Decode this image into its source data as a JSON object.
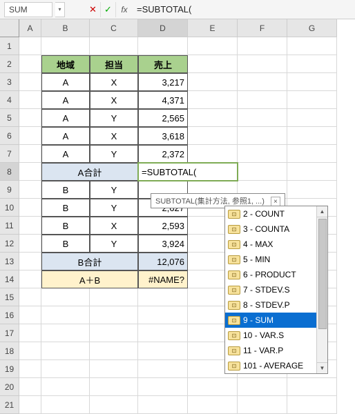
{
  "formula_bar": {
    "name_box": "SUM",
    "cancel": "✕",
    "ok": "✓",
    "fx": "fx",
    "formula": "=SUBTOTAL("
  },
  "columns": [
    "A",
    "B",
    "C",
    "D",
    "E",
    "F",
    "G"
  ],
  "rows": [
    "1",
    "2",
    "3",
    "4",
    "5",
    "6",
    "7",
    "8",
    "9",
    "10",
    "11",
    "12",
    "13",
    "14",
    "15",
    "16",
    "17",
    "18",
    "19",
    "20",
    "21"
  ],
  "headers": {
    "region": "地域",
    "rep": "担当",
    "sales": "売上"
  },
  "data": {
    "rows": [
      {
        "region": "A",
        "rep": "X",
        "sales": "3,217"
      },
      {
        "region": "A",
        "rep": "X",
        "sales": "4,371"
      },
      {
        "region": "A",
        "rep": "Y",
        "sales": "2,565"
      },
      {
        "region": "A",
        "rep": "X",
        "sales": "3,618"
      },
      {
        "region": "A",
        "rep": "Y",
        "sales": "2,372"
      }
    ],
    "subtotal_a_label": "A合計",
    "subtotal_a_edit": "=SUBTOTAL(",
    "rowsB": [
      {
        "region": "B",
        "rep": "Y",
        "sales": ""
      },
      {
        "region": "B",
        "rep": "Y",
        "sales": "2,627"
      },
      {
        "region": "B",
        "rep": "X",
        "sales": "2,593"
      },
      {
        "region": "B",
        "rep": "Y",
        "sales": "3,924"
      }
    ],
    "subtotal_b_label": "B合計",
    "subtotal_b_value": "12,076",
    "total_label": "A＋B",
    "total_value": "#NAME?"
  },
  "tooltip": {
    "text": "SUBTOTAL(集計方法, 参照1, ...)",
    "close": "×"
  },
  "dropdown": {
    "items": [
      {
        "label": "2 - COUNT",
        "selected": false
      },
      {
        "label": "3 - COUNTA",
        "selected": false
      },
      {
        "label": "4 - MAX",
        "selected": false
      },
      {
        "label": "5 - MIN",
        "selected": false
      },
      {
        "label": "6 - PRODUCT",
        "selected": false
      },
      {
        "label": "7 - STDEV.S",
        "selected": false
      },
      {
        "label": "8 - STDEV.P",
        "selected": false
      },
      {
        "label": "9 - SUM",
        "selected": true
      },
      {
        "label": "10 - VAR.S",
        "selected": false
      },
      {
        "label": "11 - VAR.P",
        "selected": false
      },
      {
        "label": "101 - AVERAGE",
        "selected": false
      }
    ],
    "up": "▲",
    "down": "▼"
  }
}
